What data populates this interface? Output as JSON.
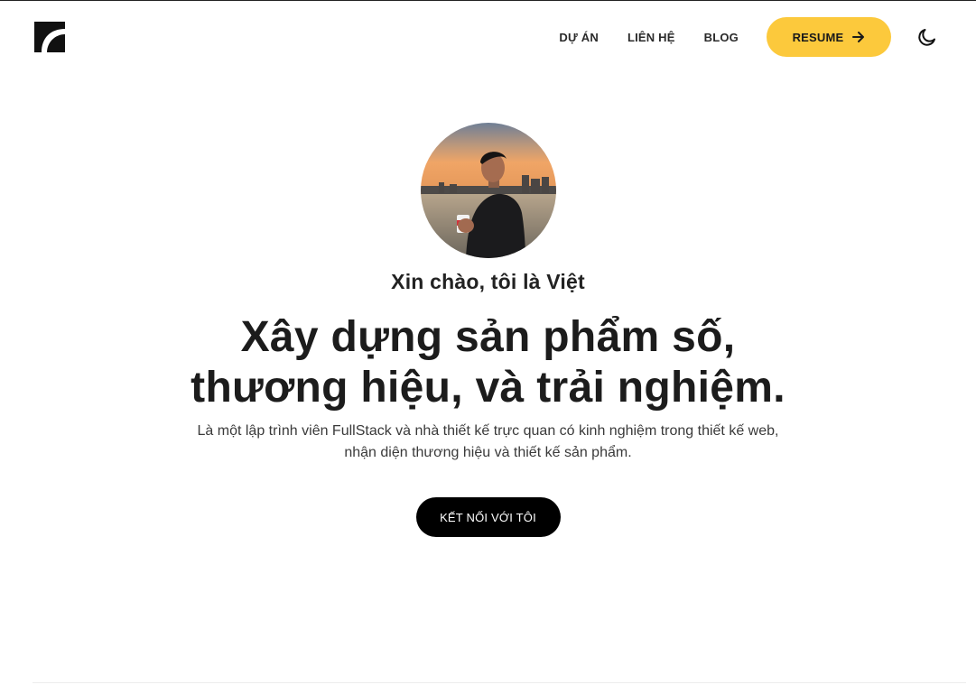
{
  "header": {
    "nav": [
      {
        "label": "DỰ ÁN"
      },
      {
        "label": "LIÊN HỆ"
      },
      {
        "label": "BLOG"
      }
    ],
    "resume_label": "RESUME",
    "accent_color": "#fcc93c"
  },
  "hero": {
    "greeting": "Xin chào, tôi là Việt",
    "headline_line1": "Xây dựng sản phẩm số,",
    "headline_line2": "thương hiệu, và trải nghiệm.",
    "intro_line1": "Là một lập trình viên FullStack và nhà thiết kế trực quan có kinh nghiệm trong thiết kế web,",
    "intro_line2": "nhận diện thương hiệu và thiết kế sản phẩm.",
    "cta_label": "KẾT NỐI VỚI TÔI"
  },
  "icons": {
    "logo": "logo-icon",
    "resume_arrow": "arrow-right-icon",
    "theme": "moon-icon"
  }
}
